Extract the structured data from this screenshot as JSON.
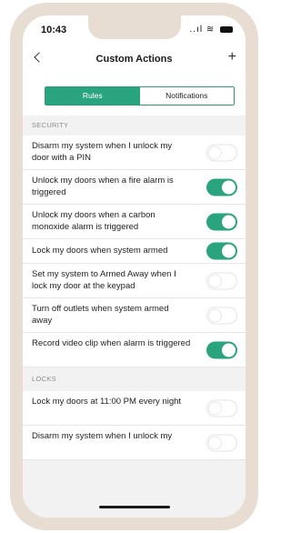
{
  "status": {
    "time": "10:43",
    "signal": "..ıl",
    "wifi": "≋"
  },
  "nav": {
    "title": "Custom Actions",
    "add": "+"
  },
  "tabs": [
    {
      "label": "Rules",
      "active": true
    },
    {
      "label": "Notifications",
      "active": false
    }
  ],
  "sections": [
    {
      "header": "SECURITY",
      "rows": [
        {
          "text": "Disarm my system when I unlock my door with a PIN",
          "on": false
        },
        {
          "text": "Unlock my doors when a fire alarm is triggered",
          "on": true
        },
        {
          "text": "Unlock my doors when a carbon monoxide alarm is triggered",
          "on": true
        },
        {
          "text": "Lock my doors when system armed",
          "on": true
        },
        {
          "text": "Set my system to Armed Away when I lock my door at the keypad",
          "on": false
        },
        {
          "text": "Turn off outlets when system armed away",
          "on": false
        },
        {
          "text": "Record video clip when alarm is triggered",
          "on": true
        }
      ]
    },
    {
      "header": "LOCKS",
      "rows": [
        {
          "text": "Lock my doors at 11:00 PM every night",
          "on": false
        },
        {
          "text": "Disarm my system when I unlock my",
          "on": false
        }
      ]
    }
  ],
  "colors": {
    "accent": "#2aa47e",
    "frame": "#e8ddd3",
    "section_bg": "#f2f2f3"
  }
}
